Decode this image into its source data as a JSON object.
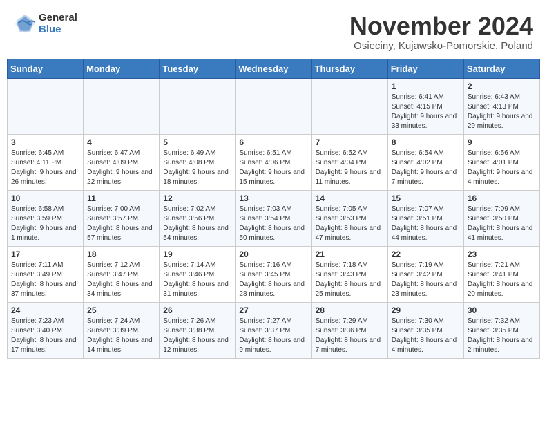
{
  "logo": {
    "general": "General",
    "blue": "Blue"
  },
  "title": "November 2024",
  "subtitle": "Osieciny, Kujawsko-Pomorskie, Poland",
  "weekdays": [
    "Sunday",
    "Monday",
    "Tuesday",
    "Wednesday",
    "Thursday",
    "Friday",
    "Saturday"
  ],
  "weeks": [
    [
      {
        "day": "",
        "info": ""
      },
      {
        "day": "",
        "info": ""
      },
      {
        "day": "",
        "info": ""
      },
      {
        "day": "",
        "info": ""
      },
      {
        "day": "",
        "info": ""
      },
      {
        "day": "1",
        "info": "Sunrise: 6:41 AM\nSunset: 4:15 PM\nDaylight: 9 hours and 33 minutes."
      },
      {
        "day": "2",
        "info": "Sunrise: 6:43 AM\nSunset: 4:13 PM\nDaylight: 9 hours and 29 minutes."
      }
    ],
    [
      {
        "day": "3",
        "info": "Sunrise: 6:45 AM\nSunset: 4:11 PM\nDaylight: 9 hours and 26 minutes."
      },
      {
        "day": "4",
        "info": "Sunrise: 6:47 AM\nSunset: 4:09 PM\nDaylight: 9 hours and 22 minutes."
      },
      {
        "day": "5",
        "info": "Sunrise: 6:49 AM\nSunset: 4:08 PM\nDaylight: 9 hours and 18 minutes."
      },
      {
        "day": "6",
        "info": "Sunrise: 6:51 AM\nSunset: 4:06 PM\nDaylight: 9 hours and 15 minutes."
      },
      {
        "day": "7",
        "info": "Sunrise: 6:52 AM\nSunset: 4:04 PM\nDaylight: 9 hours and 11 minutes."
      },
      {
        "day": "8",
        "info": "Sunrise: 6:54 AM\nSunset: 4:02 PM\nDaylight: 9 hours and 7 minutes."
      },
      {
        "day": "9",
        "info": "Sunrise: 6:56 AM\nSunset: 4:01 PM\nDaylight: 9 hours and 4 minutes."
      }
    ],
    [
      {
        "day": "10",
        "info": "Sunrise: 6:58 AM\nSunset: 3:59 PM\nDaylight: 9 hours and 1 minute."
      },
      {
        "day": "11",
        "info": "Sunrise: 7:00 AM\nSunset: 3:57 PM\nDaylight: 8 hours and 57 minutes."
      },
      {
        "day": "12",
        "info": "Sunrise: 7:02 AM\nSunset: 3:56 PM\nDaylight: 8 hours and 54 minutes."
      },
      {
        "day": "13",
        "info": "Sunrise: 7:03 AM\nSunset: 3:54 PM\nDaylight: 8 hours and 50 minutes."
      },
      {
        "day": "14",
        "info": "Sunrise: 7:05 AM\nSunset: 3:53 PM\nDaylight: 8 hours and 47 minutes."
      },
      {
        "day": "15",
        "info": "Sunrise: 7:07 AM\nSunset: 3:51 PM\nDaylight: 8 hours and 44 minutes."
      },
      {
        "day": "16",
        "info": "Sunrise: 7:09 AM\nSunset: 3:50 PM\nDaylight: 8 hours and 41 minutes."
      }
    ],
    [
      {
        "day": "17",
        "info": "Sunrise: 7:11 AM\nSunset: 3:49 PM\nDaylight: 8 hours and 37 minutes."
      },
      {
        "day": "18",
        "info": "Sunrise: 7:12 AM\nSunset: 3:47 PM\nDaylight: 8 hours and 34 minutes."
      },
      {
        "day": "19",
        "info": "Sunrise: 7:14 AM\nSunset: 3:46 PM\nDaylight: 8 hours and 31 minutes."
      },
      {
        "day": "20",
        "info": "Sunrise: 7:16 AM\nSunset: 3:45 PM\nDaylight: 8 hours and 28 minutes."
      },
      {
        "day": "21",
        "info": "Sunrise: 7:18 AM\nSunset: 3:43 PM\nDaylight: 8 hours and 25 minutes."
      },
      {
        "day": "22",
        "info": "Sunrise: 7:19 AM\nSunset: 3:42 PM\nDaylight: 8 hours and 23 minutes."
      },
      {
        "day": "23",
        "info": "Sunrise: 7:21 AM\nSunset: 3:41 PM\nDaylight: 8 hours and 20 minutes."
      }
    ],
    [
      {
        "day": "24",
        "info": "Sunrise: 7:23 AM\nSunset: 3:40 PM\nDaylight: 8 hours and 17 minutes."
      },
      {
        "day": "25",
        "info": "Sunrise: 7:24 AM\nSunset: 3:39 PM\nDaylight: 8 hours and 14 minutes."
      },
      {
        "day": "26",
        "info": "Sunrise: 7:26 AM\nSunset: 3:38 PM\nDaylight: 8 hours and 12 minutes."
      },
      {
        "day": "27",
        "info": "Sunrise: 7:27 AM\nSunset: 3:37 PM\nDaylight: 8 hours and 9 minutes."
      },
      {
        "day": "28",
        "info": "Sunrise: 7:29 AM\nSunset: 3:36 PM\nDaylight: 8 hours and 7 minutes."
      },
      {
        "day": "29",
        "info": "Sunrise: 7:30 AM\nSunset: 3:35 PM\nDaylight: 8 hours and 4 minutes."
      },
      {
        "day": "30",
        "info": "Sunrise: 7:32 AM\nSunset: 3:35 PM\nDaylight: 8 hours and 2 minutes."
      }
    ]
  ]
}
